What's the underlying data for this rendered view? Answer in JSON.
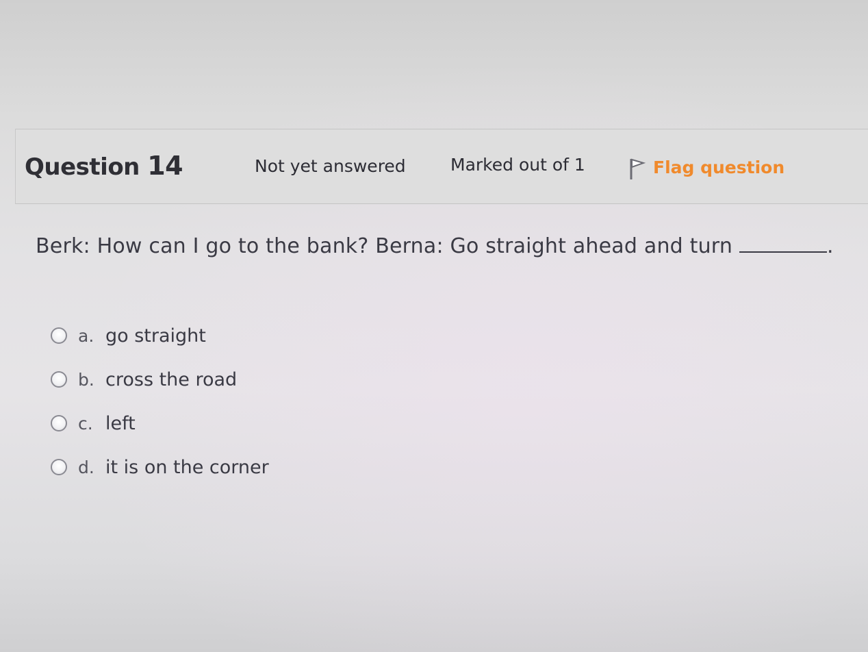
{
  "question": {
    "label": "Question",
    "number": "14",
    "state": "Not yet answered",
    "grade": "Marked out of 1",
    "flag_label": "Flag question",
    "flag_icon": "flag-icon",
    "text": "Berk: How can I go to the bank? Berna: Go straight ahead and turn",
    "text_end": ".",
    "accent_color": "#f08a2c"
  },
  "answers": [
    {
      "letter": "a.",
      "text": "go straight"
    },
    {
      "letter": "b.",
      "text": "cross the road"
    },
    {
      "letter": "c.",
      "text": "left"
    },
    {
      "letter": "d.",
      "text": "it is on the corner"
    }
  ]
}
